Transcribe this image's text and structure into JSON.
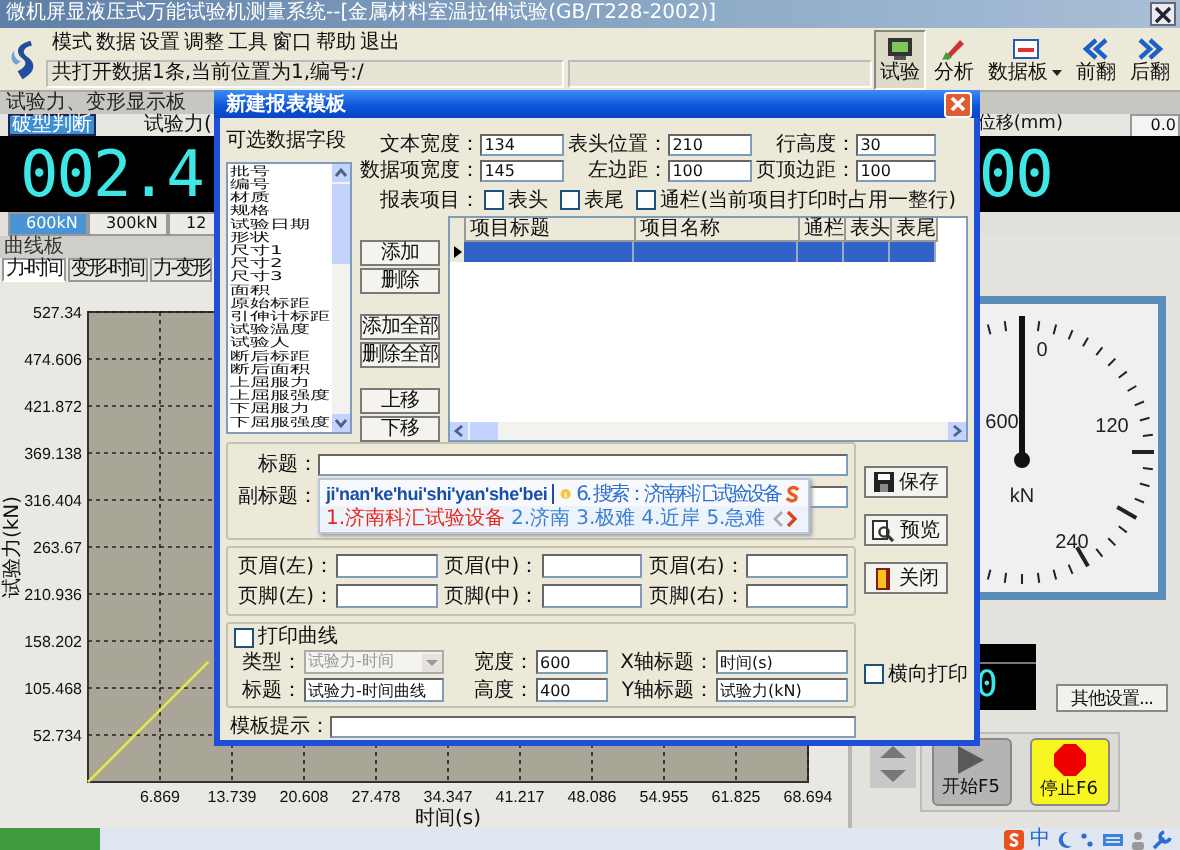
{
  "window": {
    "title": "微机屏显液压式万能试验机测量系统--[金属材料室温拉伸试验(GB/T228-2002)]"
  },
  "menu": [
    "模式",
    "数据",
    "设置",
    "调整",
    "工具",
    "窗口",
    "帮助",
    "退出"
  ],
  "status_text": "共打开数据1条,当前位置为1,编号:/",
  "toolbar": [
    {
      "label": "试验",
      "kind": "monitor",
      "selected": true
    },
    {
      "label": "分析",
      "kind": "analyze",
      "selected": false
    },
    {
      "label": "数据板",
      "kind": "board",
      "selected": false
    },
    {
      "label": "前翻",
      "kind": "prev",
      "selected": false
    },
    {
      "label": "后翻",
      "kind": "next",
      "selected": false
    }
  ],
  "display_panel": {
    "title": "试验力、变形显示板",
    "break_button": "破型判断",
    "force_header": "试验力(",
    "displacement_header": "位移(mm)",
    "displacement_value": "0.0",
    "force_reading": "002.4",
    "displacement_reading": "00",
    "ranges": [
      {
        "label": "600kN",
        "selected": true
      },
      {
        "label": "300kN",
        "selected": false
      },
      {
        "label": "12",
        "selected": false
      }
    ]
  },
  "curve_panel": {
    "title": "曲线板",
    "tabs": [
      {
        "label": "力-时间",
        "selected": true
      },
      {
        "label": "变形-时间",
        "selected": false
      },
      {
        "label": "力-变形",
        "selected": false
      }
    ],
    "chart_data": {
      "type": "line",
      "grid": true,
      "xlabel": "时间(s)",
      "ylabel": "试验力(kN)",
      "x": [
        0,
        11.5
      ],
      "series": [
        {
          "color": "#e6e64a",
          "values": [
            0,
            135
          ]
        }
      ],
      "xlim": [
        0,
        68.694
      ],
      "ylim": [
        0,
        527.34
      ],
      "xticks": [
        6.869,
        13.739,
        20.608,
        27.478,
        34.347,
        41.217,
        48.086,
        54.955,
        61.825,
        68.694
      ],
      "yticks": [
        52.734,
        105.468,
        158.202,
        210.936,
        263.67,
        316.404,
        369.138,
        421.872,
        474.606,
        527.34
      ]
    }
  },
  "gauge": {
    "labels": [
      "0",
      "600",
      "120",
      "240"
    ],
    "unit": "kN"
  },
  "side_panel": {
    "reading": "0",
    "settings_button": "其他设置...",
    "start_button": "开始F5",
    "stop_button": "停止F6"
  },
  "tray": {
    "ime_mode": "中"
  },
  "dialog": {
    "title": "新建报表模板",
    "fields_label": "可选数据字段",
    "fields": [
      "批号",
      "编号",
      "材质",
      "规格",
      "试验日期",
      "形状",
      "尺寸1",
      "尺寸2",
      "尺寸3",
      "面积",
      "原始标距",
      "引伸计标距",
      "试验温度",
      "试验人",
      "断后标距",
      "断后面积",
      "上屈服力",
      "上屈服强度",
      "下屈服力",
      "下屈服强度"
    ],
    "settings": [
      {
        "label": "文本宽度：",
        "value": "134"
      },
      {
        "label": "表头位置：",
        "value": "210"
      },
      {
        "label": "行高度：",
        "value": "30"
      },
      {
        "label": "数据项宽度：",
        "value": "145"
      },
      {
        "label": "左边距：",
        "value": "100"
      },
      {
        "label": "页顶边距：",
        "value": "100"
      }
    ],
    "report_items_label": "报表项目：",
    "report_items": [
      {
        "label": "表头",
        "checked": false
      },
      {
        "label": "表尾",
        "checked": false
      },
      {
        "label": "通栏(当前项目打印时占用一整行)",
        "checked": false
      }
    ],
    "list_buttons": [
      "添加",
      "删除",
      "添加全部",
      "删除全部",
      "上移",
      "下移"
    ],
    "grid": {
      "columns": [
        "项目标题",
        "项目名称",
        "通栏",
        "表头",
        "表尾"
      ],
      "rows": [
        {
          "selected": true
        }
      ]
    },
    "title_label": "标题：",
    "subtitle_label": "副标题：",
    "header_footer": [
      "页眉(左)：",
      "页眉(中)：",
      "页眉(右)：",
      "页脚(左)：",
      "页脚(中)：",
      "页脚(右)："
    ],
    "print_curve": {
      "label": "打印曲线",
      "checked": false,
      "type_label": "类型：",
      "type_value": "试验力-时间",
      "type_disabled": true,
      "width_label": "宽度：",
      "width_value": "600",
      "x_title_label": "X轴标题：",
      "x_title_value": "时间(s)",
      "title_label": "标题：",
      "title_value": "试验力-时间曲线",
      "height_label": "高度：",
      "height_value": "400",
      "y_title_label": "Y轴标题：",
      "y_title_value": "试验力(kN)"
    },
    "landscape": {
      "label": "横向打印",
      "checked": false
    },
    "hint_label": "模板提示：",
    "actions": [
      {
        "label": "保存",
        "kind": "save"
      },
      {
        "label": "预览",
        "kind": "preview"
      },
      {
        "label": "关闭",
        "kind": "close"
      }
    ]
  },
  "ime": {
    "composition": "ji'nan'ke'hui'shi'yan'she'bei",
    "search": "6. 搜索：济南科汇试验设备",
    "candidates": [
      {
        "text": "1.济南科汇试验设备",
        "selected": true
      },
      {
        "text": "2.济南",
        "selected": false
      },
      {
        "text": "3.极难",
        "selected": false
      },
      {
        "text": "4.近岸",
        "selected": false
      },
      {
        "text": "5.急难",
        "selected": false
      }
    ]
  }
}
